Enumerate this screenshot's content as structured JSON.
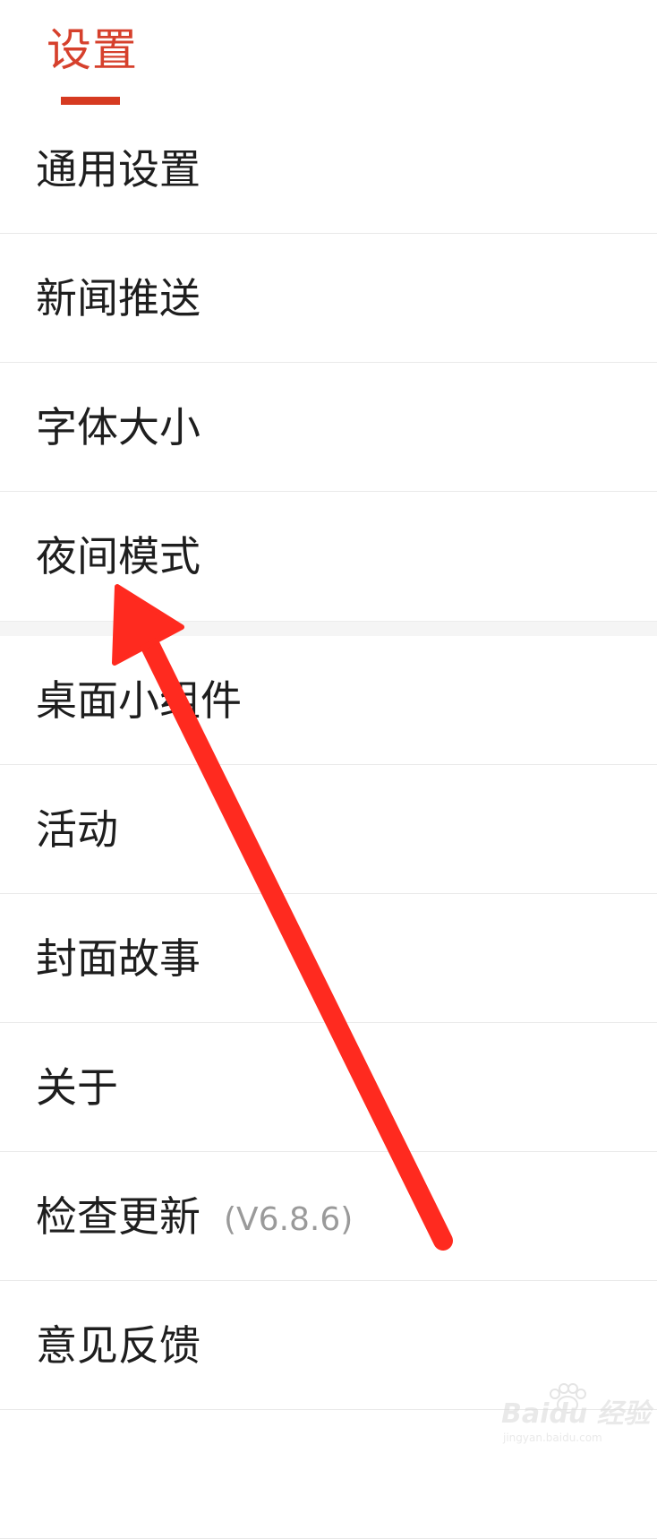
{
  "header": {
    "tab_label": "设置"
  },
  "menu": {
    "group1": [
      {
        "label": "通用设置"
      },
      {
        "label": "新闻推送"
      },
      {
        "label": "字体大小"
      },
      {
        "label": "夜间模式"
      }
    ],
    "group2": [
      {
        "label": "桌面小组件"
      },
      {
        "label": "活动"
      },
      {
        "label": "封面故事"
      },
      {
        "label": "关于"
      },
      {
        "label": "检查更新",
        "version": "(V6.8.6)"
      },
      {
        "label": "意见反馈"
      }
    ]
  },
  "annotation": {
    "arrow_color": "#ff2a1f",
    "target": "夜间模式"
  },
  "watermark": {
    "brand": "Baidu 经验",
    "domain": "jingyan.baidu.com"
  },
  "colors": {
    "accent": "#d6402c",
    "indicator": "#d63a21",
    "text": "#1e1e1e",
    "muted": "#9a9a9a",
    "divider": "#e9e9e9",
    "group_gap": "#f5f5f5"
  }
}
